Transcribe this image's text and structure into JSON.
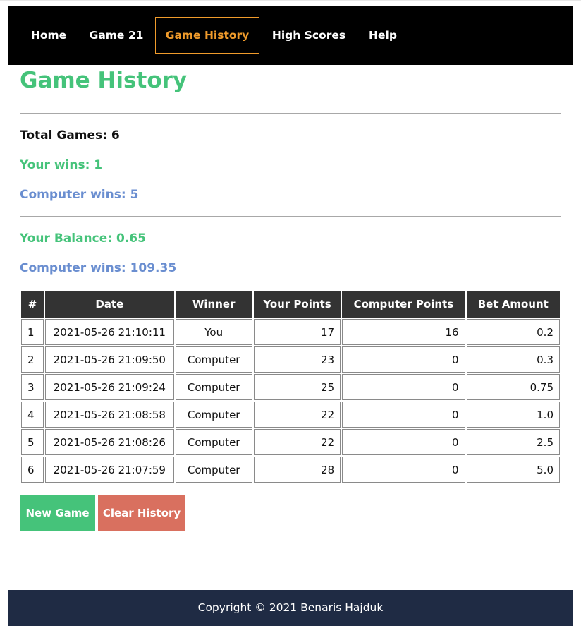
{
  "nav": {
    "items": [
      {
        "label": "Home",
        "active": false
      },
      {
        "label": "Game 21",
        "active": false
      },
      {
        "label": "Game History",
        "active": true
      },
      {
        "label": "High Scores",
        "active": false
      },
      {
        "label": "Help",
        "active": false
      }
    ]
  },
  "page": {
    "title": "Game History"
  },
  "stats": {
    "total_games": "Total Games: 6",
    "your_wins": "Your wins: 1",
    "computer_wins": "Computer wins: 5",
    "your_balance": "Your Balance: 0.65",
    "computer_balance": "Computer wins: 109.35"
  },
  "table": {
    "headers": [
      "#",
      "Date",
      "Winner",
      "Your Points",
      "Computer Points",
      "Bet Amount"
    ],
    "rows": [
      [
        "1",
        "2021-05-26 21:10:11",
        "You",
        "17",
        "16",
        "0.2"
      ],
      [
        "2",
        "2021-05-26 21:09:50",
        "Computer",
        "23",
        "0",
        "0.3"
      ],
      [
        "3",
        "2021-05-26 21:09:24",
        "Computer",
        "25",
        "0",
        "0.75"
      ],
      [
        "4",
        "2021-05-26 21:08:58",
        "Computer",
        "22",
        "0",
        "1.0"
      ],
      [
        "5",
        "2021-05-26 21:08:26",
        "Computer",
        "22",
        "0",
        "2.5"
      ],
      [
        "6",
        "2021-05-26 21:07:59",
        "Computer",
        "28",
        "0",
        "5.0"
      ]
    ]
  },
  "buttons": {
    "new_game": "New Game",
    "clear_history": "Clear History"
  },
  "footer": {
    "text": "Copyright © 2021 Benaris Hajduk"
  },
  "colors": {
    "green": "#45c37a",
    "blue": "#6a8ed0",
    "orange": "#f09b2b",
    "red": "#d9705f",
    "footer_bg": "#1f2b44",
    "table_header_bg": "#333333"
  }
}
